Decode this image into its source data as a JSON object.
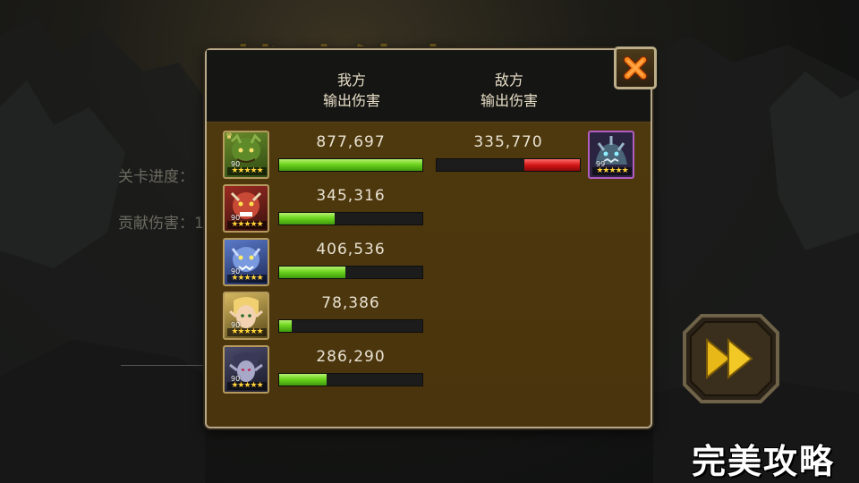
{
  "background": {
    "title": "战斗结束",
    "line1": "关卡进度：",
    "line2": "贡献伤害：1"
  },
  "panel": {
    "ours_header": "我方\n输出伤害",
    "enemy_header": "敌方\n输出伤害",
    "close_icon": "close-x-icon"
  },
  "ours": [
    {
      "damage": "877,697",
      "fill": 1.0,
      "level": "90",
      "stars": "★★★★★",
      "leader": true
    },
    {
      "damage": "345,316",
      "fill": 0.39,
      "level": "90",
      "stars": "★★★★★",
      "leader": false
    },
    {
      "damage": "406,536",
      "fill": 0.46,
      "level": "90",
      "stars": "★★★★★",
      "leader": false
    },
    {
      "damage": "78,386",
      "fill": 0.09,
      "level": "90",
      "stars": "★★★★★",
      "leader": false
    },
    {
      "damage": "286,290",
      "fill": 0.33,
      "level": "90",
      "stars": "★★★★★",
      "leader": false
    }
  ],
  "enemy": {
    "damage": "335,770",
    "fill": 0.39,
    "level": "99",
    "stars": "★★★★★"
  },
  "watermark": "完美攻略",
  "colors": {
    "ally_bar": "#6cd41e",
    "enemy_bar": "#d41717",
    "panel_body": "#4a340d",
    "frame": "#b8a88a"
  }
}
